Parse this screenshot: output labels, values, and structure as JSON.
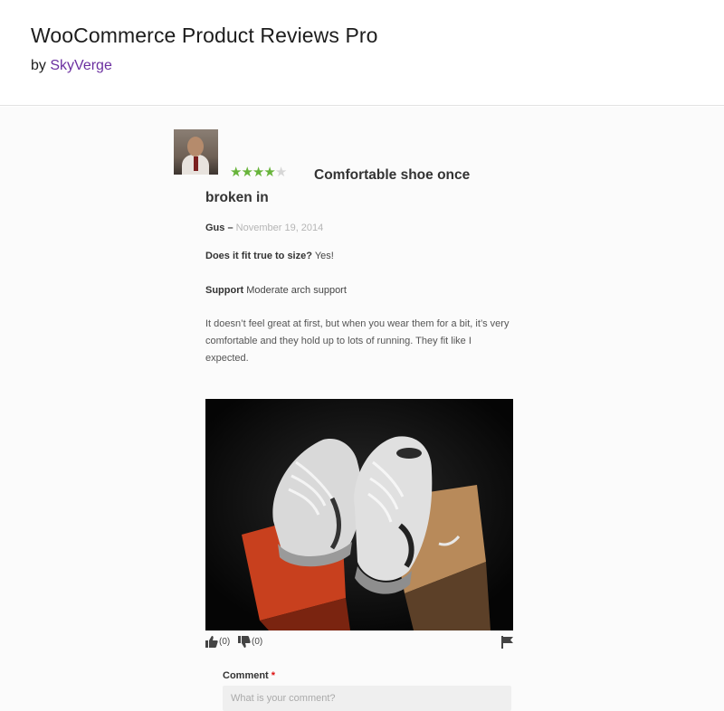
{
  "plugin": {
    "title": "WooCommerce Product Reviews Pro",
    "by_label": "by",
    "vendor": "SkyVerge"
  },
  "review": {
    "rating": 4,
    "rating_max": 5,
    "title": "Comfortable shoe once broken in",
    "author": "Gus",
    "separator": "–",
    "date": "November 19, 2014",
    "answers": [
      {
        "question": "Does it fit true to size?",
        "answer": "Yes!"
      },
      {
        "question": "Support",
        "answer": "Moderate arch support"
      }
    ],
    "text": "It doesn’t feel great at first, but when you wear them for a bit, it’s very comfortable and they hold up to lots of running. They fit like I expected.",
    "upvotes": "(0)",
    "downvotes": "(0)"
  },
  "comment_form": {
    "label": "Comment",
    "required_mark": "*",
    "placeholder": "What is your comment?"
  },
  "colors": {
    "vendor_link": "#6b2fa0",
    "star_on": "#67b43a",
    "star_off": "#d6d6d6"
  }
}
